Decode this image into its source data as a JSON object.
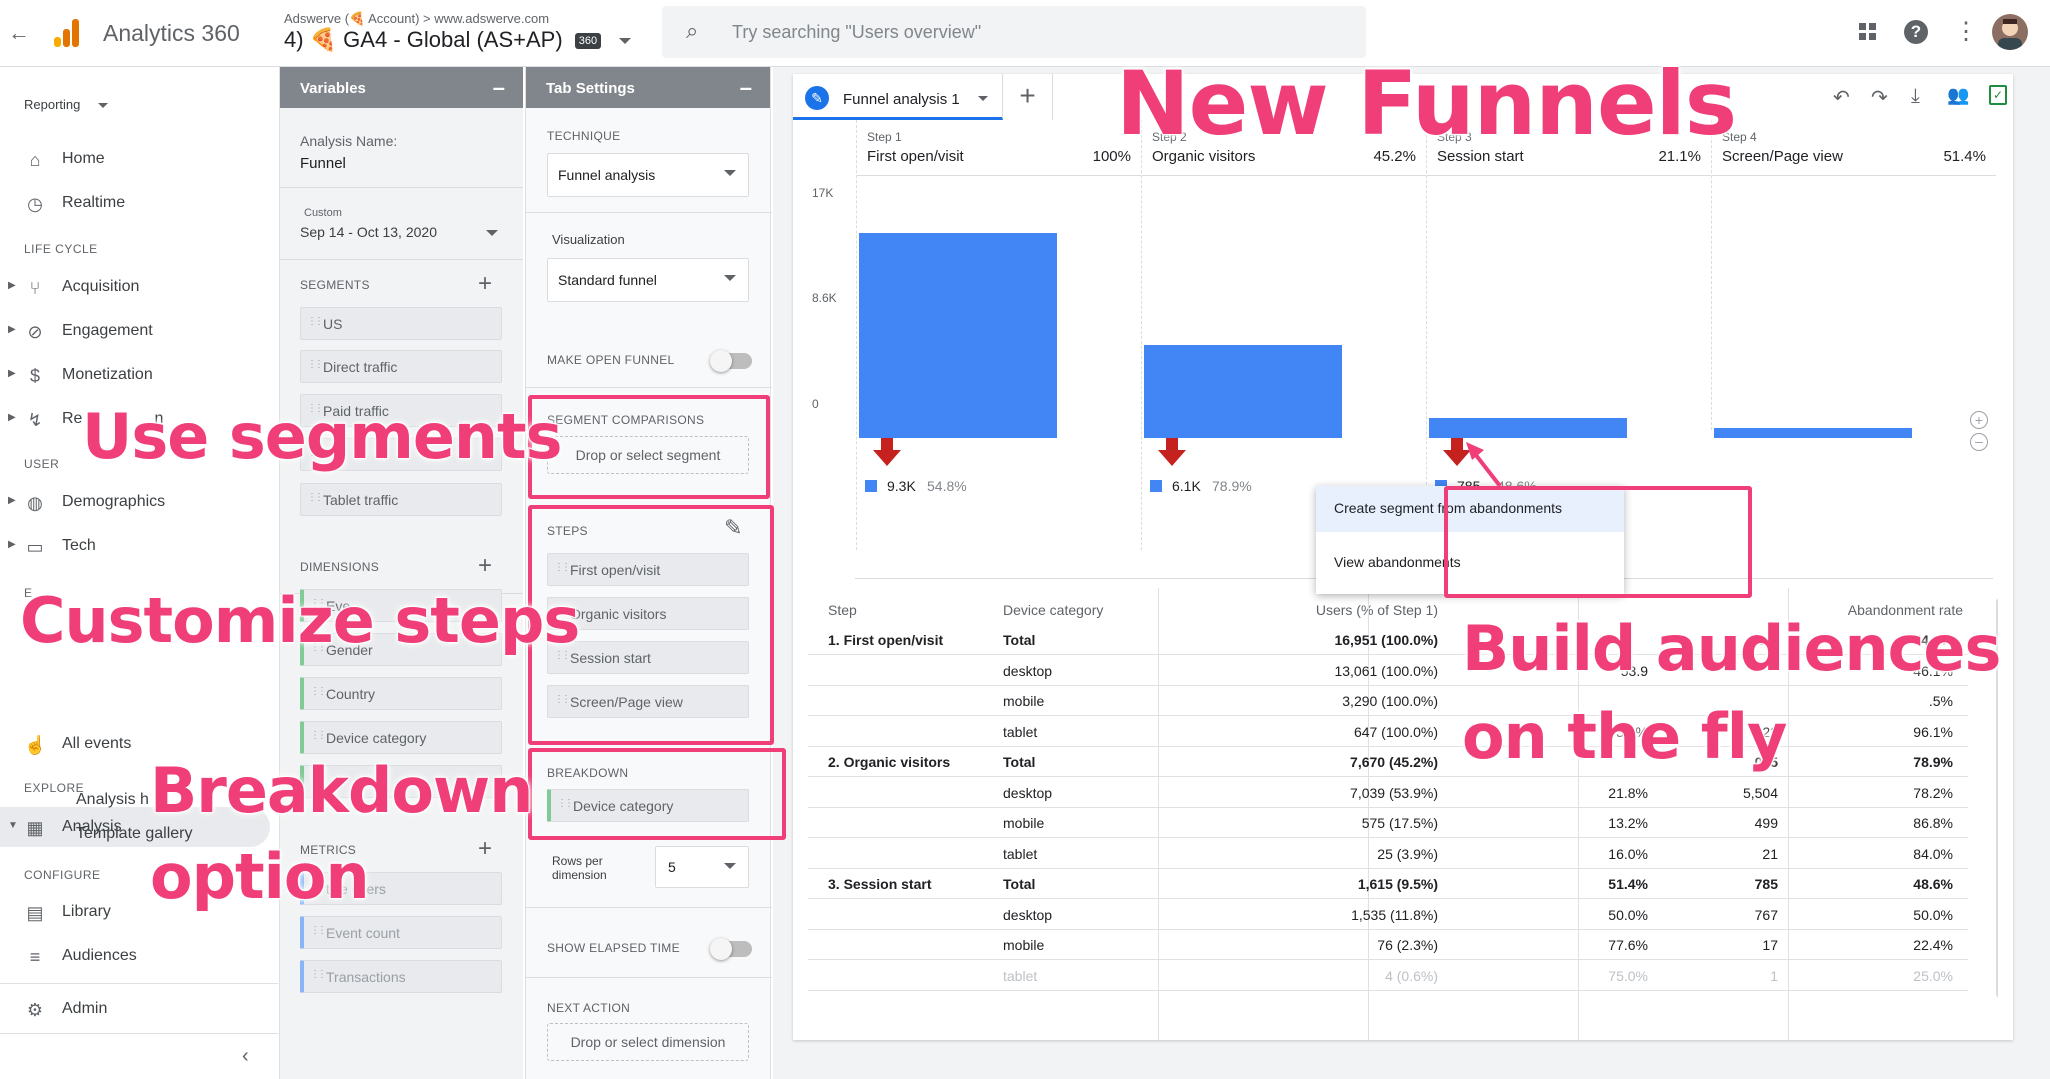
{
  "topbar": {
    "product": "Analytics 360",
    "account_line": "Adswerve (🍕 Account) > www.adswerve.com",
    "property": "4) 🍕 GA4 - Global (AS+AP)",
    "badge": "360",
    "search_placeholder": "Try searching \"Users overview\""
  },
  "nav": {
    "reporting": "Reporting",
    "home": "Home",
    "realtime": "Realtime",
    "lifecycle": "LIFE CYCLE",
    "acquisition": "Acquisition",
    "engagement": "Engagement",
    "monetization": "Monetization",
    "retention": "Re",
    "retention_tail": "n",
    "user": "USER",
    "demographics": "Demographics",
    "tech": "Tech",
    "events": "E",
    "all_events": "All events",
    "explore": "EXPLORE",
    "analysis": "Analysis",
    "analysis_hub": "Analysis h",
    "template_gallery": "Template gallery",
    "configure": "CONFIGURE",
    "library": "Library",
    "audiences": "Audiences",
    "admin": "Admin"
  },
  "variables": {
    "title": "Variables",
    "analysis_name_label": "Analysis Name:",
    "analysis_name": "Funnel",
    "date_label": "Custom",
    "date_range": "Sep 14 - Oct 13, 2020",
    "segments_title": "SEGMENTS",
    "segments": [
      "US",
      "Direct traffic",
      "Paid traffic",
      "",
      "Tablet traffic"
    ],
    "dimensions_title": "DIMENSIONS",
    "dim_event": "Eve",
    "dim_gender": "Gender",
    "dim_country": "Country",
    "dim_device": "Device category",
    "metrics_title": "METRICS",
    "metric_users": "tive users",
    "metric_event": "Event count",
    "metric_trans": "Transactions"
  },
  "tabsettings": {
    "title": "Tab Settings",
    "technique_label": "TECHNIQUE",
    "technique": "Funnel analysis",
    "visualization_label": "Visualization",
    "visualization": "Standard funnel",
    "open_funnel": "MAKE OPEN FUNNEL",
    "segment_comparisons": "SEGMENT COMPARISONS",
    "segment_drop": "Drop or select segment",
    "steps_title": "STEPS",
    "steps": [
      "First open/visit",
      "Organic visitors",
      "Session start",
      "Screen/Page view"
    ],
    "breakdown_title": "BREAKDOWN",
    "breakdown": "Device category",
    "rows_label_1": "Rows per",
    "rows_label_2": "dimension",
    "rows_value": "5",
    "elapsed": "SHOW ELAPSED TIME",
    "next_action": "NEXT ACTION",
    "next_drop": "Drop or select dimension"
  },
  "tab": {
    "name": "Funnel analysis 1"
  },
  "chart_data": {
    "type": "bar",
    "categories": [
      "First open/visit",
      "Organic visitors",
      "Session start",
      "Screen/Page view"
    ],
    "step_labels": [
      "Step 1",
      "Step 2",
      "Step 3",
      "Step 4"
    ],
    "pct_labels": [
      "100%",
      "45.2%",
      "21.1%",
      "51.4%"
    ],
    "values": [
      16951,
      7670,
      1615,
      830
    ],
    "y_ticks": [
      "17K",
      "8.6K",
      "0"
    ],
    "ylim": [
      0,
      17000
    ],
    "abandon_values": [
      "9.3K",
      "6.1K",
      "785"
    ],
    "abandon_rates": [
      "54.8%",
      "78.9%",
      "48.6%"
    ],
    "bar_color": "#4285f4"
  },
  "menu": {
    "create_segment": "Create segment from abandonments",
    "view_abandonments": "View abandonments"
  },
  "table": {
    "headers": [
      "Step",
      "Device category",
      "Users (% of Step 1)",
      "",
      "",
      "Abandonment rate"
    ],
    "rows": [
      {
        "step": "1. First open/visit",
        "device": "Total",
        "users": "16,951 (100.0%)",
        "c4": "",
        "c5": "9,2",
        "rate": "54.8%"
      },
      {
        "step": "",
        "device": "desktop",
        "users": "13,061 (100.0%)",
        "c4": "53.9",
        "c5": "",
        "rate": "46.1%"
      },
      {
        "step": "",
        "device": "mobile",
        "users": "3,290 (100.0%)",
        "c4": "",
        "c5": "",
        "rate": ".5%"
      },
      {
        "step": "",
        "device": "tablet",
        "users": "647 (100.0%)",
        "c4": "3.9%",
        "c5": "622",
        "rate": "96.1%"
      },
      {
        "step": "2. Organic visitors",
        "device": "Total",
        "users": "7,670 (45.2%)",
        "c4": "",
        "c5": "055",
        "rate": "78.9%"
      },
      {
        "step": "",
        "device": "desktop",
        "users": "7,039 (53.9%)",
        "c4": "21.8%",
        "c5": "5,504",
        "rate": "78.2%"
      },
      {
        "step": "",
        "device": "mobile",
        "users": "575 (17.5%)",
        "c4": "13.2%",
        "c5": "499",
        "rate": "86.8%"
      },
      {
        "step": "",
        "device": "tablet",
        "users": "25 (3.9%)",
        "c4": "16.0%",
        "c5": "21",
        "rate": "84.0%"
      },
      {
        "step": "3. Session start",
        "device": "Total",
        "users": "1,615 (9.5%)",
        "c4": "51.4%",
        "c5": "785",
        "rate": "48.6%"
      },
      {
        "step": "",
        "device": "desktop",
        "users": "1,535 (11.8%)",
        "c4": "50.0%",
        "c5": "767",
        "rate": "50.0%"
      },
      {
        "step": "",
        "device": "mobile",
        "users": "76 (2.3%)",
        "c4": "77.6%",
        "c5": "17",
        "rate": "22.4%"
      },
      {
        "step": "",
        "device": "tablet",
        "users": "4 (0.6%)",
        "c4": "75.0%",
        "c5": "1",
        "rate": "25.0%"
      }
    ]
  },
  "callouts": {
    "new_funnels": "New Funnels",
    "use_segments": "Use segments",
    "customize_steps": "Customize steps",
    "breakdown_1": "Breakdown",
    "breakdown_2": "option",
    "build_1": "Build audiences",
    "build_2": "on the fly"
  },
  "colors": {
    "accent": "#f03e78",
    "bar": "#4285f4",
    "arrow": "#c5221f"
  }
}
